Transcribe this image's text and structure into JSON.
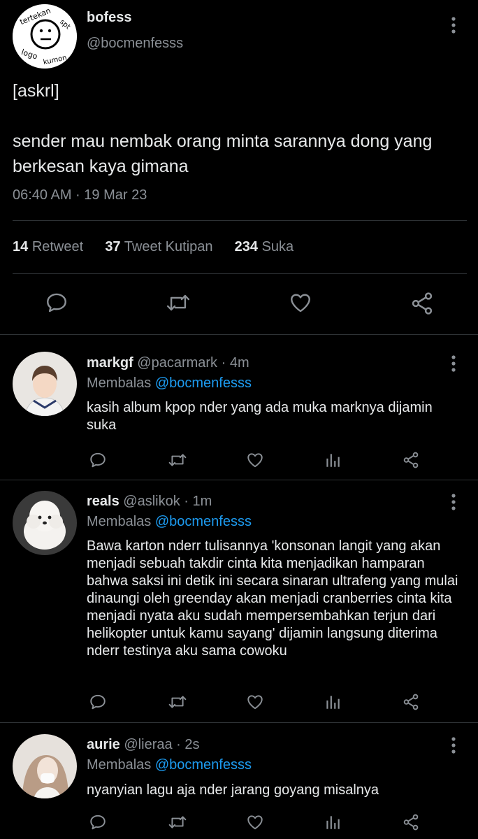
{
  "main": {
    "avatar_text": [
      "tertekan",
      "spt",
      "logo",
      "kumon"
    ],
    "name": "bofess",
    "handle": "@bocmenfesss",
    "text": "[askrl]\n\nsender mau nembak orang minta sarannya dong yang berkesan kaya gimana",
    "time": "06:40 AM · 19 Mar 23",
    "stats": {
      "retweets": "14",
      "retweets_label": "Retweet",
      "quotes": "37",
      "quotes_label": "Tweet Kutipan",
      "likes": "234",
      "likes_label": "Suka"
    }
  },
  "replies": [
    {
      "name": "markgf",
      "handle": "@pacarmark",
      "time": "· 4m",
      "replying_label": "Membalas",
      "replying_to": "@bocmenfesss",
      "text": "kasih album kpop nder yang ada muka marknya dijamin suka"
    },
    {
      "name": "reals",
      "handle": "@aslikok",
      "time": "· 1m",
      "replying_label": "Membalas",
      "replying_to": "@bocmenfesss",
      "text": "Bawa karton nderr tulisannya 'konsonan langit yang akan menjadi sebuah takdir cinta kita menjadikan hamparan bahwa saksi ini detik ini secara sinaran ultrafeng yang mulai dinaungi oleh greenday akan menjadi cranberries cinta kita menjadi nyata aku sudah mempersembahkan terjun dari helikopter untuk kamu sayang' dijamin langsung diterima nderr testinya aku sama cowoku"
    },
    {
      "name": "aurie",
      "handle": "@lieraa",
      "time": "· 2s",
      "replying_label": "Membalas",
      "replying_to": "@bocmenfesss",
      "text": "nyanyian lagu aja nder jarang goyang misalnya"
    }
  ],
  "colors": {
    "background": "#000000",
    "text": "#e7e9ea",
    "muted": "#8b9096",
    "link": "#1d9bf0",
    "divider": "#2f3336"
  },
  "icons": [
    "reply-icon",
    "retweet-icon",
    "like-icon",
    "analytics-icon",
    "share-icon",
    "more-options-icon"
  ]
}
